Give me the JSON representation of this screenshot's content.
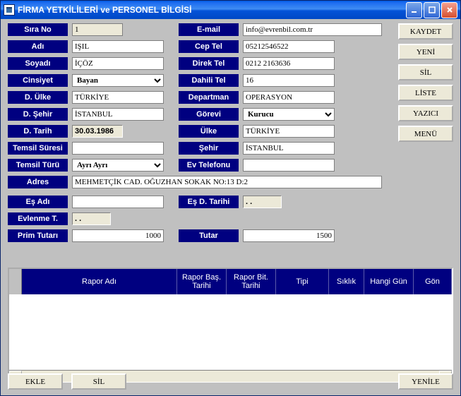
{
  "window": {
    "title": "FİRMA YETKİLİLERİ ve PERSONEL BİLGİSİ"
  },
  "labels": {
    "sira_no": "Sıra No",
    "adi": "Adı",
    "soyadi": "Soyadı",
    "cinsiyet": "Cinsiyet",
    "d_ulke": "D. Ülke",
    "d_sehir": "D. Şehir",
    "d_tarih": "D. Tarih",
    "temsil_suresi": "Temsil Süresi",
    "temsil_turu": "Temsil Türü",
    "adres": "Adres",
    "es_adi": "Eş Adı",
    "evlenme_t": "Evlenme T.",
    "prim_tutari": "Prim Tutarı",
    "email": "E-mail",
    "cep_tel": "Cep Tel",
    "direk_tel": "Direk Tel",
    "dahili_tel": "Dahili Tel",
    "departman": "Departman",
    "gorevi": "Görevi",
    "ulke": "Ülke",
    "sehir": "Şehir",
    "ev_telefonu": "Ev Telefonu",
    "es_d_tarihi": "Eş D. Tarihi",
    "tutar": "Tutar"
  },
  "values": {
    "sira_no": "1",
    "adi": "IŞIL",
    "soyadi": "İÇÖZ",
    "cinsiyet": "Bayan",
    "d_ulke": "TÜRKİYE",
    "d_sehir": "İSTANBUL",
    "d_tarih": "30.03.1986",
    "temsil_suresi": "",
    "temsil_turu": "Ayrı Ayrı",
    "adres": "MEHMETÇİK CAD. OĞUZHAN SOKAK NO:13 D:2",
    "es_adi": "",
    "evlenme_t": "  .  .",
    "prim_tutari": "1000",
    "email": "info@evrenbil.com.tr",
    "cep_tel": "05212546522",
    "direk_tel": "0212 2163636",
    "dahili_tel": "16",
    "departman": "OPERASYON",
    "gorevi": "Kurucu",
    "ulke": "TÜRKİYE",
    "sehir": "İSTANBUL",
    "ev_telefonu": "",
    "es_d_tarihi": "  .  .",
    "tutar": "1500"
  },
  "buttons": {
    "kaydet": "KAYDET",
    "yeni": "YENİ",
    "sil": "SİL",
    "liste": "LİSTE",
    "yazici": "YAZICI",
    "menu": "MENÜ",
    "ekle": "EKLE",
    "sil2": "SİL",
    "yenile": "YENİLE"
  },
  "grid": {
    "headers": [
      "Rapor Adı",
      "Rapor Baş. Tarihi",
      "Rapor Bit. Tarihi",
      "Tipi",
      "Sıklık",
      "Hangi Gün",
      "Gön"
    ]
  }
}
